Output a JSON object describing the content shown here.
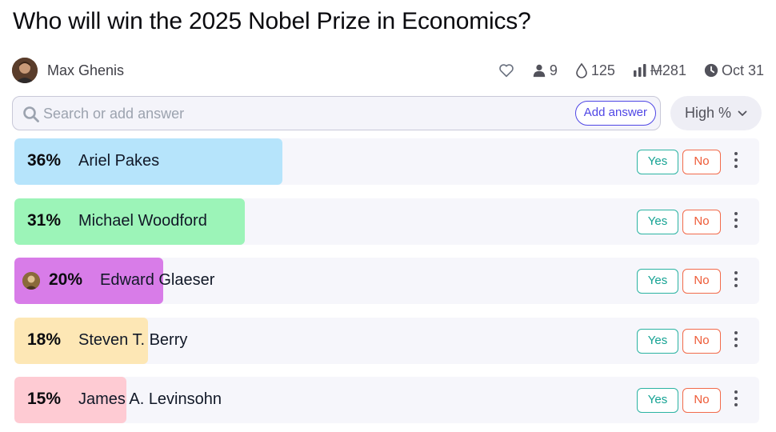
{
  "question": {
    "title": "Who will win the 2025 Nobel Prize in Economics?"
  },
  "author": {
    "name": "Max Ghenis"
  },
  "stats": {
    "traders": "9",
    "liquidity": "125",
    "volume": "281",
    "volume_currency": "M",
    "close_date": "Oct 31",
    "icons": [
      "heart-icon",
      "user-icon",
      "droplet-icon",
      "bar-chart-icon",
      "clock-icon"
    ]
  },
  "search": {
    "placeholder": "Search or add answer",
    "value": "",
    "add_label": "Add answer"
  },
  "sort": {
    "label": "High %"
  },
  "buttons": {
    "yes": "Yes",
    "no": "No"
  },
  "answers": [
    {
      "pct_label": "36%",
      "probability": 0.36,
      "name": "Ariel Pakes",
      "color": "#b6e4fb"
    },
    {
      "pct_label": "31%",
      "probability": 0.31,
      "name": "Michael Woodford",
      "color": "#9cf4b8"
    },
    {
      "pct_label": "20%",
      "probability": 0.2,
      "name": "Edward Glaeser",
      "color": "#d87ce8",
      "has_avatar": true
    },
    {
      "pct_label": "18%",
      "probability": 0.18,
      "name": "Steven T. Berry",
      "color": "#fde7b5"
    },
    {
      "pct_label": "15%",
      "probability": 0.15,
      "name": "James A. Levinsohn",
      "color": "#fecbd3"
    }
  ],
  "colors": {
    "accent": "#4f46e5",
    "yes": "#14a293",
    "no": "#ee5a36"
  }
}
